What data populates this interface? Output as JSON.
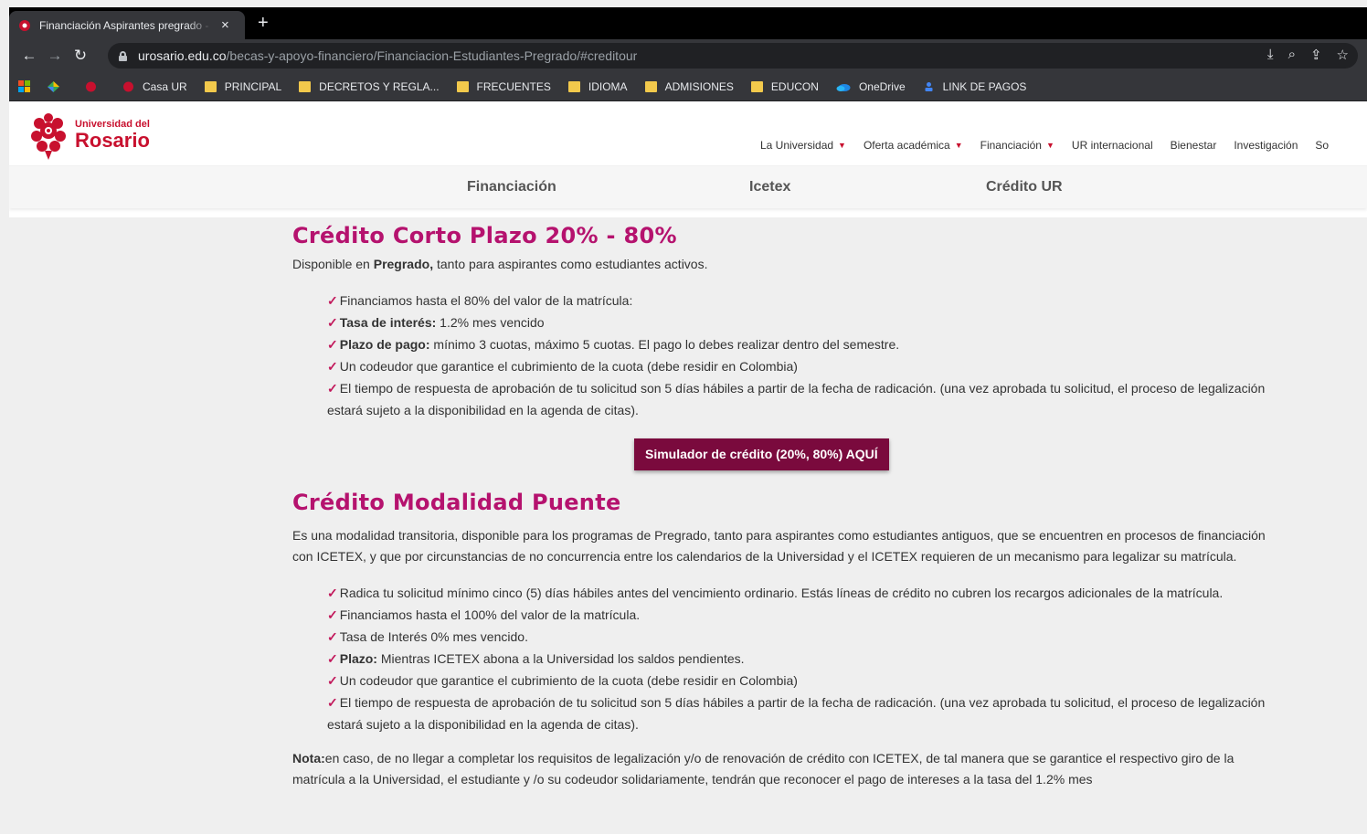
{
  "browser": {
    "tab_title": "Financiación Aspirantes pregrado - Universidad del Rosario",
    "tab_close": "×",
    "new_tab": "+",
    "url_host": "urosario.edu.co",
    "url_path": "/becas-y-apoyo-financiero/Financiacion-Estudiantes-Pregrado/#creditour",
    "icons": [
      "back-icon",
      "forward-icon",
      "reload-icon",
      "lock-icon",
      "install-icon",
      "zoom-icon",
      "share-icon",
      "star-icon"
    ]
  },
  "bookmarks": [
    {
      "label": "",
      "icon": "apps"
    },
    {
      "label": "",
      "icon": "colorful"
    },
    {
      "label": "",
      "icon": "ur-red"
    },
    {
      "label": "Casa UR",
      "icon": "ur-red"
    },
    {
      "label": "PRINCIPAL",
      "icon": "folder"
    },
    {
      "label": "DECRETOS Y REGLA...",
      "icon": "folder"
    },
    {
      "label": "FRECUENTES",
      "icon": "folder"
    },
    {
      "label": "IDIOMA",
      "icon": "folder"
    },
    {
      "label": "ADMISIONES",
      "icon": "folder"
    },
    {
      "label": "EDUCON",
      "icon": "folder"
    },
    {
      "label": "OneDrive",
      "icon": "cloud"
    },
    {
      "label": "LINK DE PAGOS",
      "icon": "person"
    }
  ],
  "site": {
    "logo_small": "Universidad del",
    "logo_big": "Rosario",
    "nav": [
      {
        "label": "La Universidad",
        "caret": true
      },
      {
        "label": "Oferta académica",
        "caret": true
      },
      {
        "label": "Financiación",
        "caret": true
      },
      {
        "label": "UR internacional",
        "caret": false
      },
      {
        "label": "Bienestar",
        "caret": false
      },
      {
        "label": "Investigación",
        "caret": false
      },
      {
        "label": "So",
        "caret": false
      }
    ],
    "subnav": [
      "Financiación",
      "Icetex",
      "Crédito UR"
    ]
  },
  "section1": {
    "title": "Crédito Corto Plazo 20% - 80%",
    "intro_pre": "Disponible en ",
    "intro_bold": "Pregrado,",
    "intro_post": " tanto para aspirantes como estudiantes activos.",
    "items": [
      {
        "bold": "",
        "text": "Financiamos hasta el 80% del valor de la matrícula:"
      },
      {
        "bold": "Tasa de interés:",
        "text": " 1.2% mes vencido"
      },
      {
        "bold": "Plazo de pago:",
        "text": " mínimo 3 cuotas, máximo 5 cuotas. El pago lo debes realizar dentro del semestre."
      },
      {
        "bold": "",
        "text": "Un codeudor que garantice el cubrimiento de la cuota (debe residir en Colombia)"
      },
      {
        "bold": "",
        "text": "El tiempo de respuesta de aprobación de tu solicitud son 5 días hábiles a partir de la fecha de radicación. (una vez aprobada tu solicitud, el proceso de legalización estará sujeto a la disponibilidad en la agenda de citas)."
      }
    ],
    "button_pre": "Simulador de crédito (20%, 80%) ",
    "button_bold": "AQUÍ"
  },
  "section2": {
    "title": "Crédito Modalidad Puente",
    "intro": "Es una modalidad transitoria, disponible para los programas de Pregrado, tanto para aspirantes como estudiantes antiguos, que se encuentren en procesos de financiación con ICETEX, y que por circunstancias de no concurrencia entre los calendarios de la Universidad y el ICETEX requieren de un mecanismo para legalizar su matrícula.",
    "items": [
      {
        "bold": "",
        "text": "Radica tu solicitud mínimo cinco (5) días hábiles antes del vencimiento ordinario. Estás líneas de crédito no cubren los recargos adicionales de la matrícula."
      },
      {
        "bold": "",
        "text": "Financiamos hasta el 100% del valor de la matrícula."
      },
      {
        "bold": "",
        "text": "Tasa de Interés 0% mes vencido."
      },
      {
        "bold": "Plazo:",
        "text": " Mientras ICETEX abona a la Universidad los saldos pendientes."
      },
      {
        "bold": "",
        "text": "Un codeudor que garantice el cubrimiento de la cuota (debe residir en Colombia)"
      },
      {
        "bold": "",
        "text": "El tiempo de respuesta de aprobación de tu solicitud son 5 días hábiles a partir de la fecha de radicación. (una vez aprobada tu solicitud, el proceso de legalización estará sujeto a la disponibilidad en la agenda de citas)."
      }
    ],
    "note_bold": "Nota:",
    "note_text": "en caso, de no llegar a completar los requisitos de legalización y/o de renovación de crédito con ICETEX, de tal manera que se garantice el respectivo giro de la matrícula a la Universidad, el estudiante y /o su codeudor solidariamente, tendrán que reconocer el pago de intereses a la tasa del 1.2% mes"
  },
  "colors": {
    "accent": "#b5126e",
    "button": "#7a0a3d",
    "brand_red": "#c8102e"
  }
}
